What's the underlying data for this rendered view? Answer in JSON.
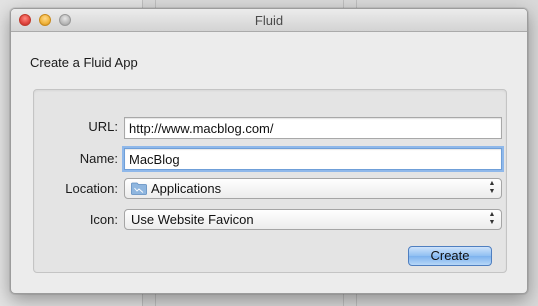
{
  "window": {
    "title": "Fluid"
  },
  "heading": "Create a Fluid App",
  "form": {
    "url": {
      "label": "URL:",
      "value": "http://www.macblog.com/"
    },
    "name": {
      "label": "Name:",
      "value": "MacBlog"
    },
    "location": {
      "label": "Location:",
      "value": "Applications",
      "icon": "folder-icon"
    },
    "icon": {
      "label": "Icon:",
      "value": "Use Website Favicon"
    }
  },
  "buttons": {
    "create": "Create"
  },
  "colors": {
    "accent": "#8fbff2",
    "focus_ring": "#8fb8ea"
  }
}
